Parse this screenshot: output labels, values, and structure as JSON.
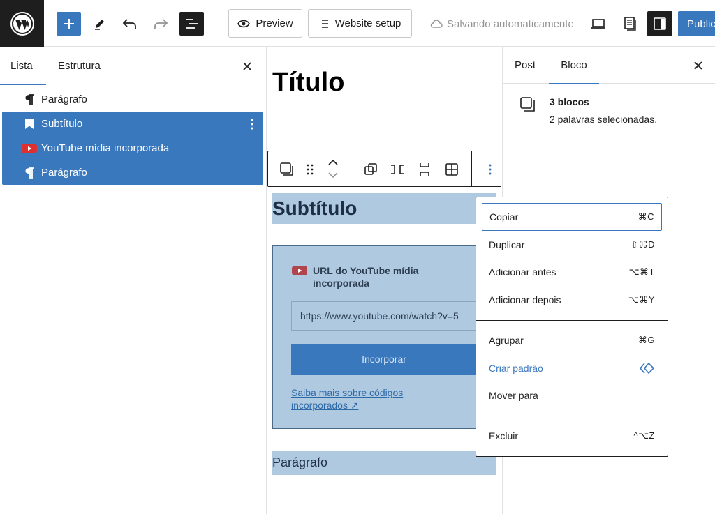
{
  "topbar": {
    "preview_label": "Preview",
    "website_setup_label": "Website setup",
    "autosave_text": "Salvando automaticamente",
    "publish_label": "Public"
  },
  "list_view": {
    "tabs": [
      {
        "label": "Lista",
        "active": true
      },
      {
        "label": "Estrutura",
        "active": false
      }
    ],
    "items": [
      {
        "label": "Parágrafo",
        "icon": "paragraph-icon",
        "selected": false
      },
      {
        "label": "Subtítulo",
        "icon": "bookmark-icon",
        "selected": true
      },
      {
        "label": "YouTube mídia incorporada",
        "icon": "youtube-icon",
        "selected": true
      },
      {
        "label": "Parágrafo",
        "icon": "paragraph-icon",
        "selected": true
      }
    ]
  },
  "canvas": {
    "title": "Título",
    "subheading": "Subtítulo",
    "embed": {
      "label": "URL do YouTube mídia incorporada",
      "input_value": "https://www.youtube.com/watch?v=5",
      "button_label": "Incorporar",
      "link_text": "Saiba mais sobre códigos incorporados ↗"
    },
    "paragraph": "Parágrafo"
  },
  "sidebar": {
    "tabs": [
      {
        "label": "Post",
        "active": false
      },
      {
        "label": "Bloco",
        "active": true
      }
    ],
    "blocks_count": "3 blocos",
    "words_selected": "2 palavras selecionadas."
  },
  "menu": {
    "items": [
      {
        "label": "Copiar",
        "shortcut": "⌘C"
      },
      {
        "label": "Duplicar",
        "shortcut": "⇧⌘D"
      },
      {
        "label": "Adicionar antes",
        "shortcut": "⌥⌘T"
      },
      {
        "label": "Adicionar depois",
        "shortcut": "⌥⌘Y"
      },
      {
        "label": "Agrupar",
        "shortcut": "⌘G"
      },
      {
        "label": "Criar padrão",
        "shortcut": ""
      },
      {
        "label": "Mover para",
        "shortcut": ""
      },
      {
        "label": "Excluir",
        "shortcut": "^⌥Z"
      }
    ]
  },
  "colors": {
    "accent": "#3a78be",
    "dark": "#1e1e1e",
    "selection": "#afc9e0",
    "youtube_red": "#e02f2f"
  }
}
